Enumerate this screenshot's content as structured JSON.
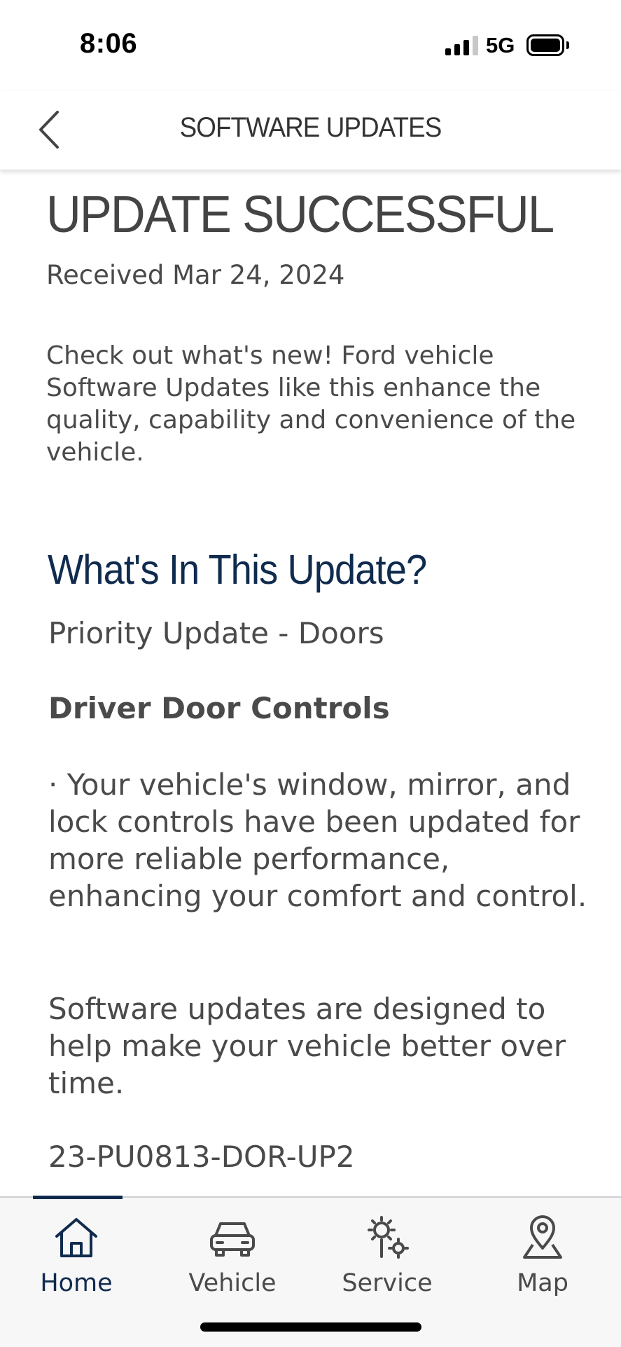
{
  "status_bar": {
    "time": "8:06",
    "network": "5G",
    "signal_bars": 3,
    "battery_icon": "battery-full-icon"
  },
  "header": {
    "title": "SOFTWARE UPDATES",
    "back_icon": "chevron-left-icon"
  },
  "update": {
    "status_title": "UPDATE SUCCESSFUL",
    "received": "Received Mar 24, 2024",
    "intro": "Check out what's new! Ford vehicle Software Updates like this enhance the quality, capability and convenience of the vehicle.",
    "section_heading": "What's In This Update?",
    "priority": "Priority Update - Doors",
    "subsection_title": "Driver Door Controls",
    "bullet": "· Your vehicle's window, mirror, and lock controls have been updated for more reliable performance, enhancing your comfort and control.",
    "closing": "Software updates are designed to help make your vehicle better over time.",
    "code": "23-PU0813-DOR-UP2"
  },
  "bottom_nav": {
    "items": [
      {
        "label": "Home",
        "icon": "home-icon",
        "active": true
      },
      {
        "label": "Vehicle",
        "icon": "car-icon",
        "active": false
      },
      {
        "label": "Service",
        "icon": "service-gear-icon",
        "active": false
      },
      {
        "label": "Map",
        "icon": "map-pin-icon",
        "active": false
      }
    ]
  },
  "colors": {
    "heading_blue": "#102b4e",
    "text_gray": "#4a4a4a",
    "nav_background": "#f7f7f8"
  }
}
